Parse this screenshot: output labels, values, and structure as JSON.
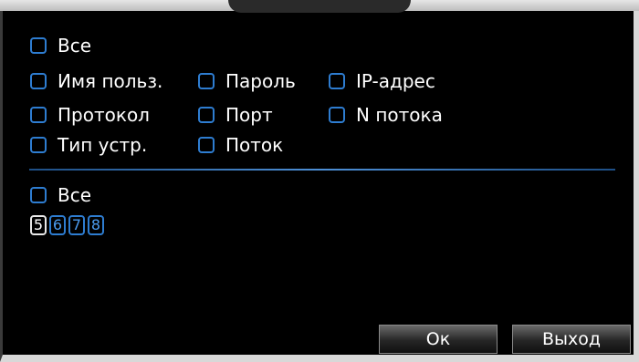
{
  "group1": {
    "all": "Все",
    "options": {
      "username": "Имя польз.",
      "password": "Пароль",
      "ip": "IP-адрес",
      "protocol": "Протокол",
      "port": "Порт",
      "stream_n": "N потока",
      "device_type": "Тип устр.",
      "stream": "Поток"
    }
  },
  "group2": {
    "all": "Все",
    "channels": [
      "5",
      "6",
      "7",
      "8"
    ]
  },
  "buttons": {
    "ok": "Ок",
    "exit": "Выход"
  },
  "colors": {
    "accent": "#2e7dd1",
    "background": "#000000"
  }
}
